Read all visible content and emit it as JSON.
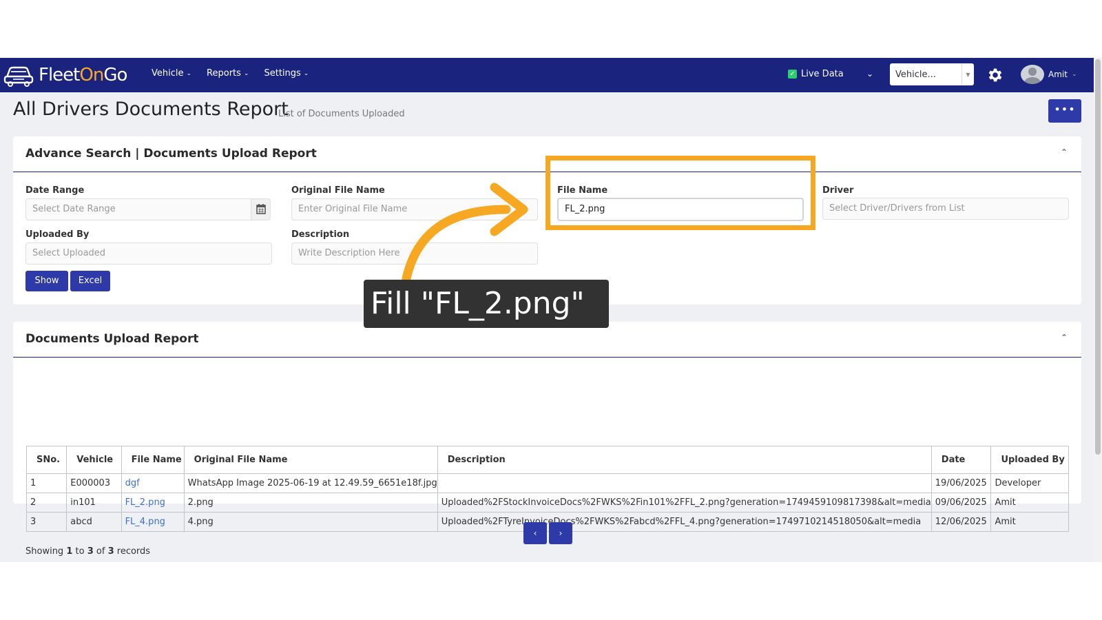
{
  "app": {
    "logo_fleet": "Fleet",
    "logo_on": "On",
    "logo_go": "Go",
    "nav": [
      {
        "label": "Vehicle"
      },
      {
        "label": "Reports"
      },
      {
        "label": "Settings"
      }
    ],
    "live_data_label": "Live Data",
    "vehicle_select_value": "Vehicle...",
    "user_name": "Amit"
  },
  "page": {
    "title": "All Drivers Documents Report",
    "subtitle": "List of Documents Uploaded",
    "more_label": "•••"
  },
  "search_panel": {
    "title": "Advance Search | Documents Upload Report",
    "date_range_label": "Date Range",
    "date_range_placeholder": "Select Date Range",
    "original_file_label": "Original File Name",
    "original_file_placeholder": "Enter Original File Name",
    "file_name_label": "File Name",
    "file_name_value": "FL_2.png",
    "driver_label": "Driver",
    "driver_placeholder": "Select Driver/Drivers from List",
    "uploaded_by_label": "Uploaded By",
    "uploaded_by_placeholder": "Select Uploaded",
    "description_label": "Description",
    "description_placeholder": "Write Description Here",
    "show_button": "Show",
    "excel_button": "Excel"
  },
  "report_panel": {
    "title": "Documents Upload Report",
    "columns": [
      "SNo.",
      "Vehicle",
      "File Name",
      "Original File Name",
      "Description",
      "Date",
      "Uploaded By"
    ],
    "rows": [
      {
        "sno": "1",
        "vehicle": "E000003",
        "file_name": "dgf",
        "original_file_name": "WhatsApp Image 2025-06-19 at 12.49.59_6651e18f.jpg",
        "description": "",
        "date": "19/06/2025",
        "uploaded_by": "Developer"
      },
      {
        "sno": "2",
        "vehicle": "in101",
        "file_name": "FL_2.png",
        "original_file_name": "2.png",
        "description": "Uploaded%2FStockInvoiceDocs%2FWKS%2Fin101%2FFL_2.png?generation=1749459109817398&alt=media",
        "date": "09/06/2025",
        "uploaded_by": "Amit"
      },
      {
        "sno": "3",
        "vehicle": "abcd",
        "file_name": "FL_4.png",
        "original_file_name": "4.png",
        "description": "Uploaded%2FTyreInvoiceDocs%2FWKS%2Fabcd%2FFL_4.png?generation=1749710214518050&alt=media",
        "date": "12/06/2025",
        "uploaded_by": "Amit"
      }
    ],
    "showing_prefix": "Showing",
    "showing_from": "1",
    "showing_to_word": "to",
    "showing_to": "3",
    "showing_of_word": "of",
    "showing_total": "3",
    "showing_suffix": "records"
  },
  "pagination": {
    "prev": "‹",
    "next": "›"
  },
  "annotation": {
    "callout_text": "Fill \"FL_2.png\"",
    "highlight_color": "#f7a823"
  }
}
